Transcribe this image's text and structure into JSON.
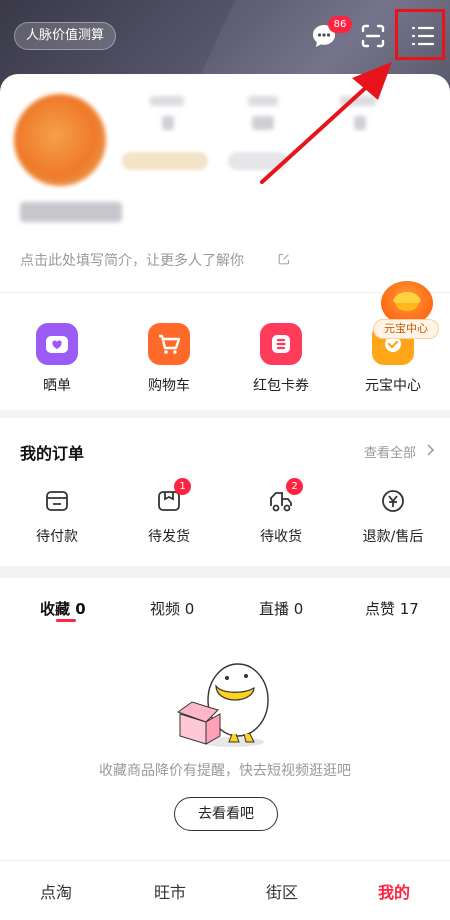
{
  "header": {
    "network_value_button": "人脉价值测算",
    "message_badge": "86",
    "icons": [
      "message-icon",
      "scan-icon",
      "menu-icon"
    ]
  },
  "profile": {
    "bio_placeholder": "点击此处填写简介，让更多人了解你"
  },
  "shortcuts": [
    {
      "label": "晒单",
      "icon": "share-order-icon",
      "color": "#9b5cf6"
    },
    {
      "label": "购物车",
      "icon": "cart-icon",
      "color": "#ff6a2b"
    },
    {
      "label": "红包卡券",
      "icon": "coupon-icon",
      "color": "#ff3b5c"
    },
    {
      "label": "元宝中心",
      "icon": "ingot-icon",
      "color": "#ffa51a"
    }
  ],
  "ingot_float": {
    "label": "元宝中心"
  },
  "orders": {
    "title": "我的订单",
    "view_all": "查看全部",
    "items": [
      {
        "label": "待付款",
        "badge": ""
      },
      {
        "label": "待发货",
        "badge": "1"
      },
      {
        "label": "待收货",
        "badge": "2"
      },
      {
        "label": "退款/售后",
        "badge": ""
      }
    ]
  },
  "content_tabs": [
    {
      "label": "收藏 0"
    },
    {
      "label": "视频 0"
    },
    {
      "label": "直播 0"
    },
    {
      "label": "点赞 17"
    }
  ],
  "empty_state": {
    "message": "收藏商品降价有提醒，快去短视频逛逛吧",
    "button": "去看看吧"
  },
  "bottom_nav": [
    {
      "label": "点淘"
    },
    {
      "label": "旺市"
    },
    {
      "label": "街区"
    },
    {
      "label": "我的"
    }
  ],
  "colors": {
    "accent": "#ff2442",
    "highlight": "#e8141c"
  }
}
